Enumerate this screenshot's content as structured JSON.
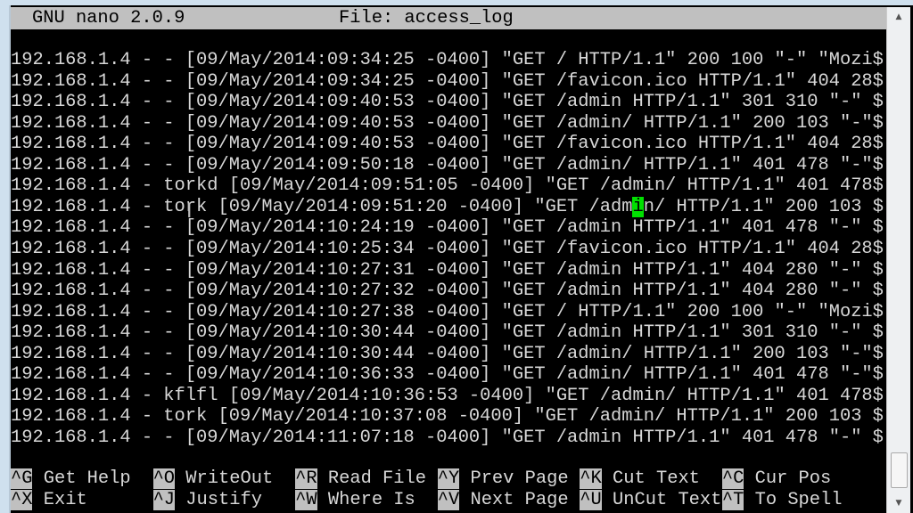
{
  "header": {
    "app": "GNU nano 2.0.9",
    "file": "File: access_log"
  },
  "lines": [
    "192.168.1.4 - - [09/May/2014:09:34:25 -0400] \"GET / HTTP/1.1\" 200 100 \"-\" \"Mozi$",
    "192.168.1.4 - - [09/May/2014:09:34:25 -0400] \"GET /favicon.ico HTTP/1.1\" 404 28$",
    "192.168.1.4 - - [09/May/2014:09:40:53 -0400] \"GET /admin HTTP/1.1\" 301 310 \"-\" $",
    "192.168.1.4 - - [09/May/2014:09:40:53 -0400] \"GET /admin/ HTTP/1.1\" 200 103 \"-\"$",
    "192.168.1.4 - - [09/May/2014:09:40:53 -0400] \"GET /favicon.ico HTTP/1.1\" 404 28$",
    "192.168.1.4 - - [09/May/2014:09:50:18 -0400] \"GET /admin/ HTTP/1.1\" 401 478 \"-\"$",
    "192.168.1.4 - torkd [09/May/2014:09:51:05 -0400] \"GET /admin/ HTTP/1.1\" 401 478$",
    "",
    "192.168.1.4 - - [09/May/2014:10:24:19 -0400] \"GET /admin HTTP/1.1\" 401 478 \"-\" $",
    "192.168.1.4 - - [09/May/2014:10:25:34 -0400] \"GET /favicon.ico HTTP/1.1\" 404 28$",
    "192.168.1.4 - - [09/May/2014:10:27:31 -0400] \"GET /admin HTTP/1.1\" 404 280 \"-\" $",
    "192.168.1.4 - - [09/May/2014:10:27:32 -0400] \"GET /admin HTTP/1.1\" 404 280 \"-\" $",
    "192.168.1.4 - - [09/May/2014:10:27:38 -0400] \"GET / HTTP/1.1\" 200 100 \"-\" \"Mozi$",
    "192.168.1.4 - - [09/May/2014:10:30:44 -0400] \"GET /admin HTTP/1.1\" 301 310 \"-\" $",
    "192.168.1.4 - - [09/May/2014:10:30:44 -0400] \"GET /admin/ HTTP/1.1\" 200 103 \"-\"$",
    "192.168.1.4 - - [09/May/2014:10:36:33 -0400] \"GET /admin/ HTTP/1.1\" 401 478 \"-\"$",
    "192.168.1.4 - kflfl [09/May/2014:10:36:53 -0400] \"GET /admin/ HTTP/1.1\" 401 478$",
    "192.168.1.4 - tork [09/May/2014:10:37:08 -0400] \"GET /admin/ HTTP/1.1\" 200 103 $",
    "192.168.1.4 - - [09/May/2014:11:07:18 -0400] \"GET /admin HTTP/1.1\" 401 478 \"-\" $"
  ],
  "cursor_line": {
    "before": "192.168.1.4 - tork [09/May/2014:09:51:20 -0400] \"GET /adm",
    "cursor": "i",
    "after": "n/ HTTP/1.1\" 200 103 $"
  },
  "shortcuts": [
    [
      {
        "key": "^G",
        "label": "Get Help"
      },
      {
        "key": "^O",
        "label": "WriteOut"
      },
      {
        "key": "^R",
        "label": "Read File"
      },
      {
        "key": "^Y",
        "label": "Prev Page"
      },
      {
        "key": "^K",
        "label": "Cut Text"
      },
      {
        "key": "^C",
        "label": "Cur Pos"
      }
    ],
    [
      {
        "key": "^X",
        "label": "Exit"
      },
      {
        "key": "^J",
        "label": "Justify"
      },
      {
        "key": "^W",
        "label": "Where Is"
      },
      {
        "key": "^V",
        "label": "Next Page"
      },
      {
        "key": "^U",
        "label": "UnCut Text"
      },
      {
        "key": "^T",
        "label": "To Spell"
      }
    ]
  ],
  "colors": {
    "cursor": "#00e000",
    "background": "#000000",
    "text": "#d8d8d8",
    "bar": "#c0c0c0"
  }
}
